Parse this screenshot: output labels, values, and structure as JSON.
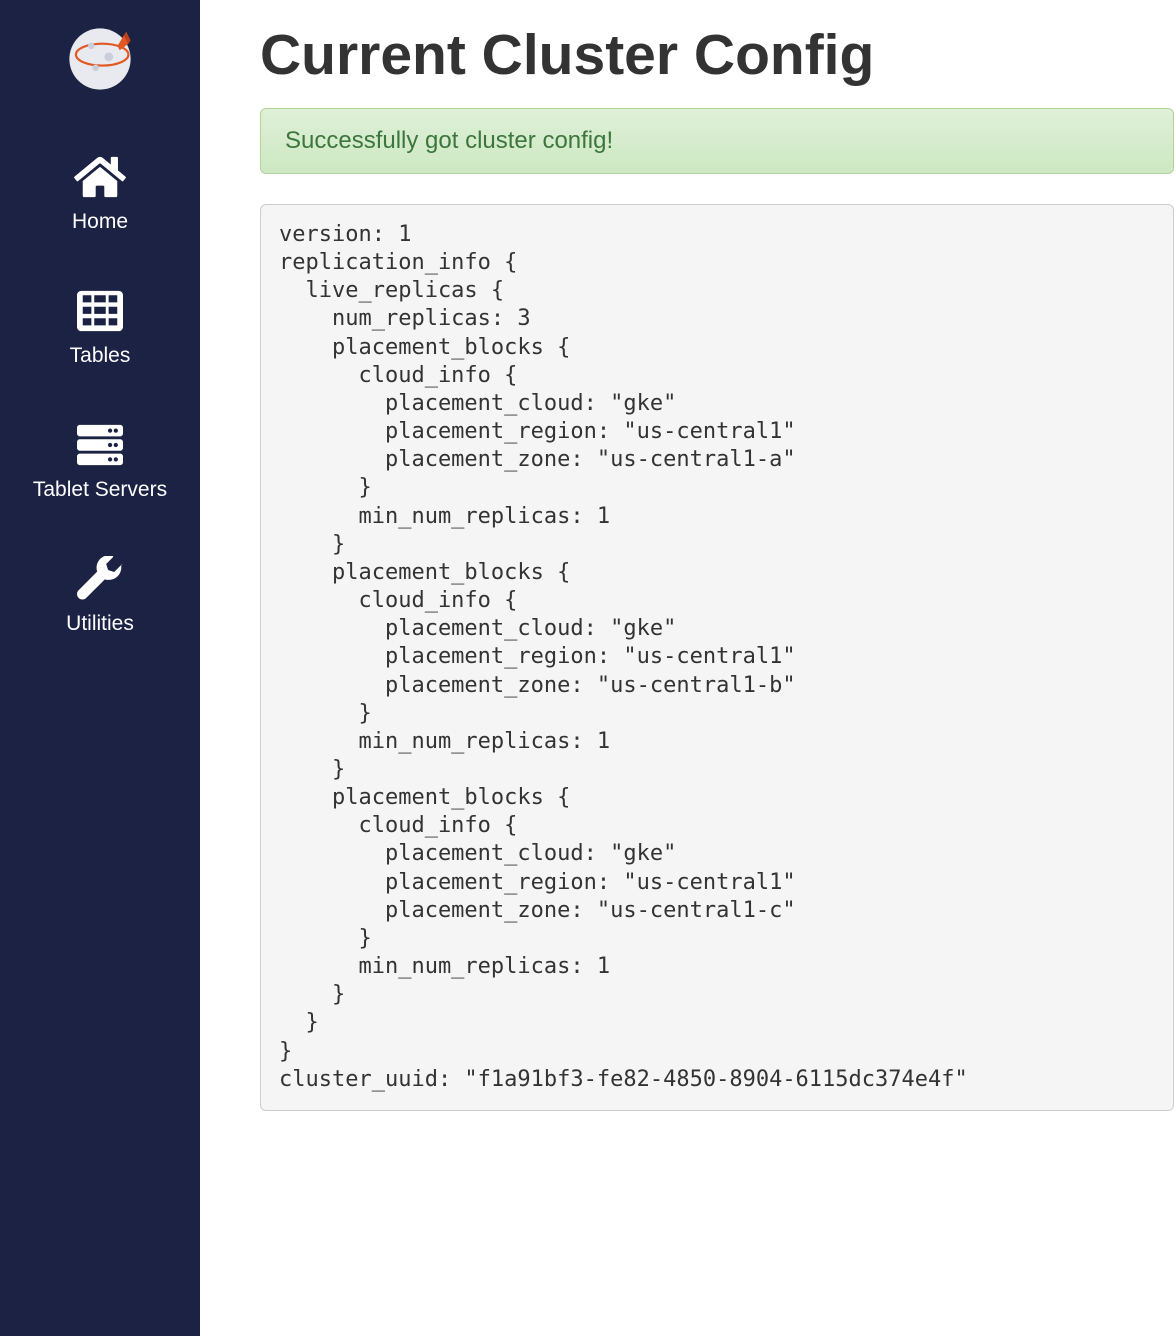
{
  "sidebar": {
    "items": [
      {
        "id": "home",
        "label": "Home",
        "icon": "home-icon"
      },
      {
        "id": "tables",
        "label": "Tables",
        "icon": "table-icon"
      },
      {
        "id": "tablet-servers",
        "label": "Tablet Servers",
        "icon": "server-icon"
      },
      {
        "id": "utilities",
        "label": "Utilities",
        "icon": "wrench-icon"
      }
    ]
  },
  "page": {
    "title": "Current Cluster Config",
    "alert": "Successfully got cluster config!"
  },
  "config_text": "version: 1\nreplication_info {\n  live_replicas {\n    num_replicas: 3\n    placement_blocks {\n      cloud_info {\n        placement_cloud: \"gke\"\n        placement_region: \"us-central1\"\n        placement_zone: \"us-central1-a\"\n      }\n      min_num_replicas: 1\n    }\n    placement_blocks {\n      cloud_info {\n        placement_cloud: \"gke\"\n        placement_region: \"us-central1\"\n        placement_zone: \"us-central1-b\"\n      }\n      min_num_replicas: 1\n    }\n    placement_blocks {\n      cloud_info {\n        placement_cloud: \"gke\"\n        placement_region: \"us-central1\"\n        placement_zone: \"us-central1-c\"\n      }\n      min_num_replicas: 1\n    }\n  }\n}\ncluster_uuid: \"f1a91bf3-fe82-4850-8904-6115dc374e4f\""
}
